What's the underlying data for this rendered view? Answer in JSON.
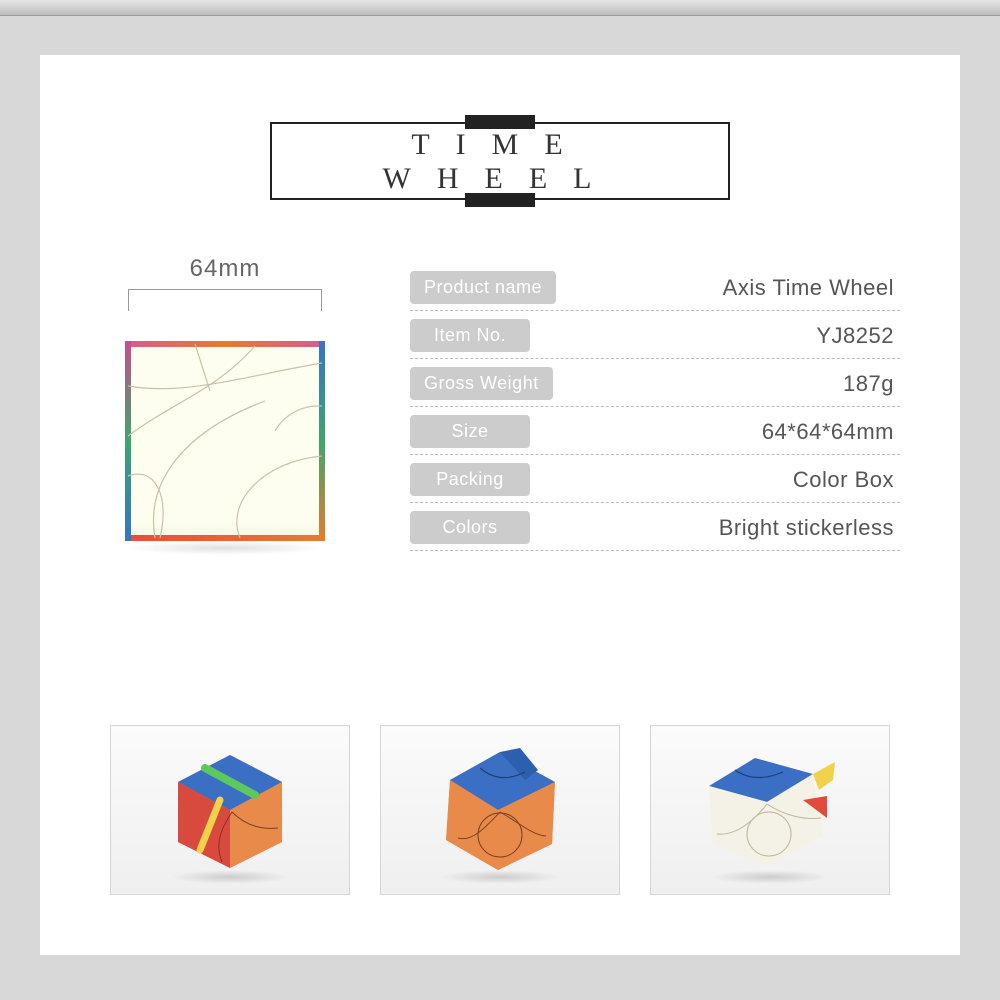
{
  "title": "TIME WHEEL",
  "dimension_label": "64mm",
  "specs": [
    {
      "label": "Product name",
      "value": "Axis Time Wheel"
    },
    {
      "label": "Item No.",
      "value": "YJ8252"
    },
    {
      "label": "Gross Weight",
      "value": "187g"
    },
    {
      "label": "Size",
      "value": "64*64*64mm"
    },
    {
      "label": "Packing",
      "value": "Color Box"
    },
    {
      "label": "Colors",
      "value": "Bright stickerless"
    }
  ]
}
